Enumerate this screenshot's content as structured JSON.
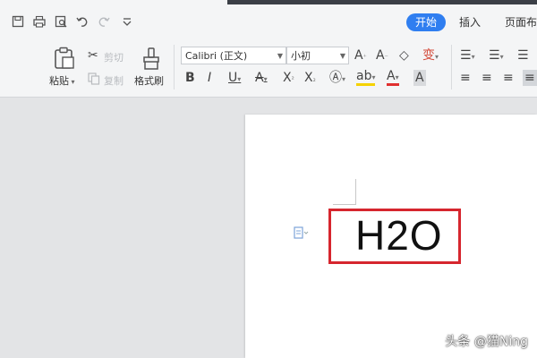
{
  "quick_access": {
    "icons": [
      "save-icon",
      "print-icon",
      "print-preview-icon",
      "undo-icon",
      "redo-icon",
      "customize-icon"
    ]
  },
  "tabs": [
    {
      "label": "开始",
      "active": true
    },
    {
      "label": "插入",
      "active": false
    },
    {
      "label": "页面布",
      "active": false
    }
  ],
  "ribbon": {
    "paste_label": "粘贴",
    "cut_label": "剪切",
    "copy_label": "复制",
    "format_painter_label": "格式刷",
    "font_name": "Calibri (正文)",
    "font_size": "小初"
  },
  "document": {
    "text": "H2O",
    "highlight_color": "#d6262e"
  },
  "watermark": "头条 @猫Ning",
  "colors": {
    "accent": "#2f7ef0",
    "workspace": "#e3e4e6"
  }
}
